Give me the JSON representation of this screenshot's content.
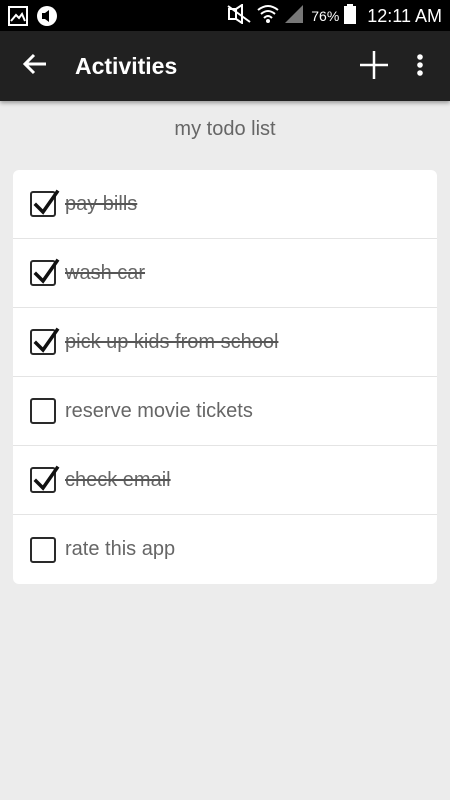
{
  "status_bar": {
    "battery": "76%",
    "time": "12:11 AM"
  },
  "app_bar": {
    "title": "Activities"
  },
  "list": {
    "title": "my todo list",
    "items": [
      {
        "label": "pay bills",
        "done": true
      },
      {
        "label": "wash car",
        "done": true
      },
      {
        "label": "pick up kids from school",
        "done": true
      },
      {
        "label": "reserve movie tickets",
        "done": false
      },
      {
        "label": "check email",
        "done": true
      },
      {
        "label": "rate this app",
        "done": false
      }
    ]
  },
  "colors": {
    "status_bar": "#000000",
    "app_bar": "#212121",
    "background": "#ececec",
    "card": "#ffffff",
    "text": "#666666"
  }
}
